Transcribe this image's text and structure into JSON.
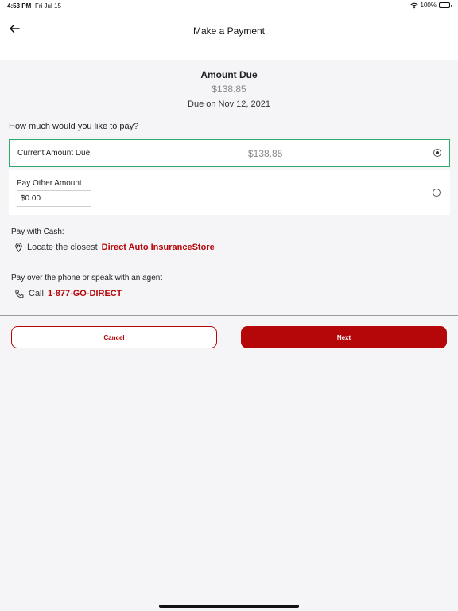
{
  "status_bar": {
    "time": "4:53 PM",
    "date": "Fri Jul 15",
    "battery": "100%"
  },
  "nav": {
    "title": "Make a Payment"
  },
  "amount": {
    "title": "Amount Due",
    "value": "$138.85",
    "due_date": "Due on Nov 12, 2021"
  },
  "question": "How much would you like to pay?",
  "options": {
    "current": {
      "label": "Current Amount Due",
      "amount": "$138.85",
      "selected": true
    },
    "other": {
      "label": "Pay Other Amount",
      "input_value": "$0.00",
      "selected": false
    }
  },
  "cash": {
    "label": "Pay with Cash:",
    "prefix": "Locate the closest",
    "link": "Direct Auto InsuranceStore"
  },
  "phone": {
    "label": "Pay over the phone or speak with an agent",
    "prefix": "Call",
    "link": "1-877-GO-DIRECT"
  },
  "buttons": {
    "cancel": "Cancel",
    "next": "Next"
  },
  "colors": {
    "accent": "#b5070a",
    "selected_border": "#2eab6b",
    "background": "#f5f5f7"
  }
}
